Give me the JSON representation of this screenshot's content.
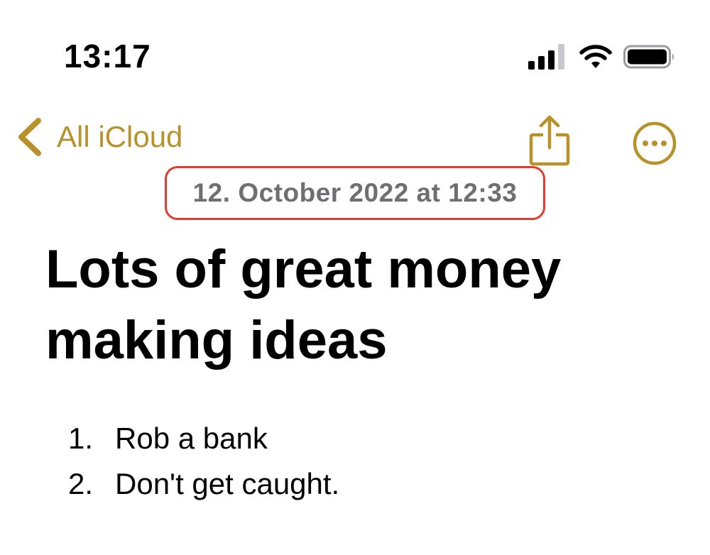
{
  "status_bar": {
    "time": "13:17",
    "icons": [
      "cellular-signal-icon",
      "wifi-icon",
      "battery-icon"
    ]
  },
  "nav": {
    "back_label": "All iCloud",
    "back_icon": "chevron-left-icon",
    "share_icon": "share-icon",
    "more_icon": "ellipsis-circle-icon",
    "accent_color": "#B8912A"
  },
  "note": {
    "date": "12. October 2022 at 12:33",
    "title": "Lots of great money making ideas",
    "items": [
      {
        "number": "1.",
        "text": "Rob a bank"
      },
      {
        "number": "2.",
        "text": "Don't get caught."
      }
    ],
    "highlight_color": "#E53A2F"
  }
}
